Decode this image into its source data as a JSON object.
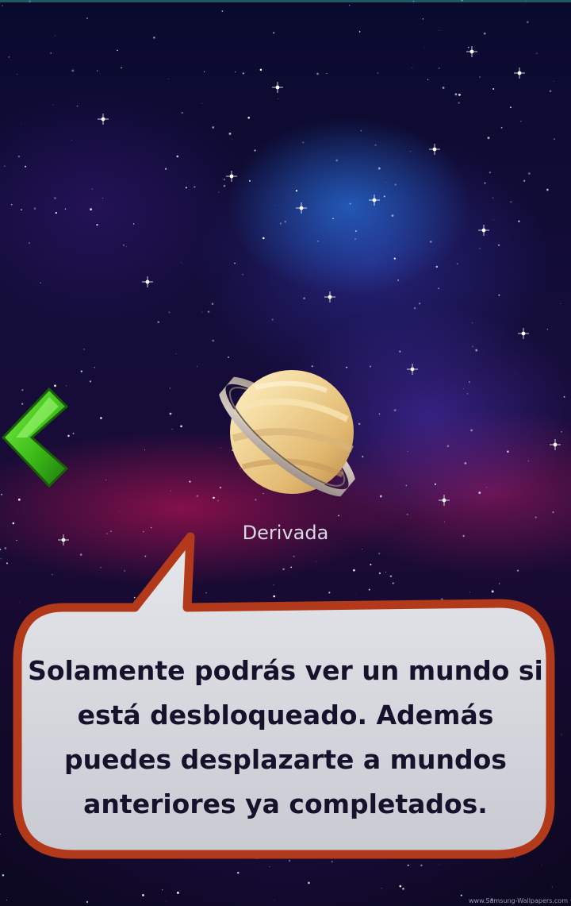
{
  "world": {
    "name": "Derivada",
    "icon": "saturn-planet-icon"
  },
  "navigation": {
    "back_icon": "chevron-left-icon",
    "arrow_color": "#3fbf1a"
  },
  "tutorial": {
    "message": "Solamente podrás ver un mundo si está desbloqueado. Además puedes desplazarte a mundos anteriores ya completados.",
    "border_color": "#b23a1a",
    "fill_color": "#dcdde2"
  },
  "watermark": "www.Samsung-Wallpapers.com"
}
